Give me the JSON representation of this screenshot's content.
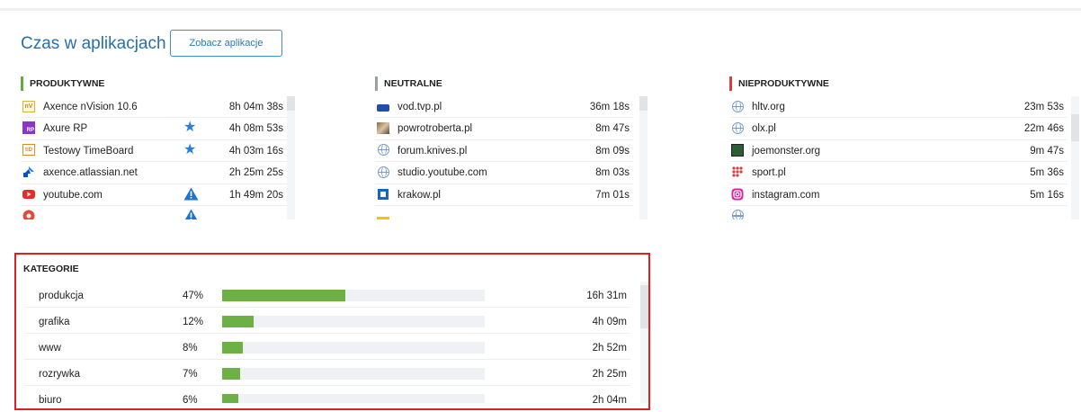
{
  "header": {
    "title": "Czas w aplikacjach",
    "see_apps_button": "Zobacz aplikacje"
  },
  "columns": [
    {
      "label": "PRODUKTYWNE",
      "accent": "#5cb03c",
      "items": [
        {
          "name": "Axence nVision 10.6",
          "time": "8h 04m 38s",
          "icon": "axence-nvision-icon",
          "mark": ""
        },
        {
          "name": "Axure RP",
          "time": "4h 08m 53s",
          "icon": "axure-rp-icon",
          "mark": "star"
        },
        {
          "name": "Testowy TimeBoard",
          "time": "4h 03m 16s",
          "icon": "timeboard-icon",
          "mark": "star"
        },
        {
          "name": "axence.atlassian.net",
          "time": "2h 25m 25s",
          "icon": "atlassian-icon",
          "mark": ""
        },
        {
          "name": "youtube.com",
          "time": "1h 49m 20s",
          "icon": "youtube-icon",
          "mark": "warning"
        },
        {
          "name": "",
          "time": "",
          "icon": "chrome-icon",
          "mark": "warning"
        }
      ]
    },
    {
      "label": "NEUTRALNE",
      "accent": "#9aa0a6",
      "items": [
        {
          "name": "vod.tvp.pl",
          "time": "36m 18s",
          "icon": "tvp-icon",
          "mark": ""
        },
        {
          "name": "powrotroberta.pl",
          "time": "8m 47s",
          "icon": "image-icon",
          "mark": ""
        },
        {
          "name": "forum.knives.pl",
          "time": "8m 09s",
          "icon": "globe-icon",
          "mark": ""
        },
        {
          "name": "studio.youtube.com",
          "time": "8m 03s",
          "icon": "globe-icon",
          "mark": ""
        },
        {
          "name": "krakow.pl",
          "time": "7m 01s",
          "icon": "krakow-icon",
          "mark": ""
        },
        {
          "name": "",
          "time": "",
          "icon": "yellow-site-icon",
          "mark": ""
        }
      ]
    },
    {
      "label": "NIEPRODUKTYWNE",
      "accent": "#e53935",
      "items": [
        {
          "name": "hltv.org",
          "time": "23m 53s",
          "icon": "globe-icon",
          "mark": ""
        },
        {
          "name": "olx.pl",
          "time": "22m 46s",
          "icon": "globe-icon",
          "mark": ""
        },
        {
          "name": "joemonster.org",
          "time": "9m 47s",
          "icon": "joemonster-icon",
          "mark": ""
        },
        {
          "name": "sport.pl",
          "time": "5m 36s",
          "icon": "sport-pl-icon",
          "mark": ""
        },
        {
          "name": "instagram.com",
          "time": "5m 16s",
          "icon": "instagram-icon",
          "mark": ""
        },
        {
          "name": "",
          "time": "",
          "icon": "globe-icon",
          "mark": ""
        }
      ]
    }
  ],
  "categories": {
    "title": "KATEGORIE",
    "bar_color": "#6db045",
    "items": [
      {
        "name": "produkcja",
        "percent": "47%",
        "fraction": 0.47,
        "time": "16h 31m"
      },
      {
        "name": "grafika",
        "percent": "12%",
        "fraction": 0.12,
        "time": "4h 09m"
      },
      {
        "name": "www",
        "percent": "8%",
        "fraction": 0.08,
        "time": "2h 52m"
      },
      {
        "name": "rozrywka",
        "percent": "7%",
        "fraction": 0.07,
        "time": "2h 25m"
      },
      {
        "name": "biuro",
        "percent": "6%",
        "fraction": 0.06,
        "time": "2h 04m"
      }
    ]
  }
}
